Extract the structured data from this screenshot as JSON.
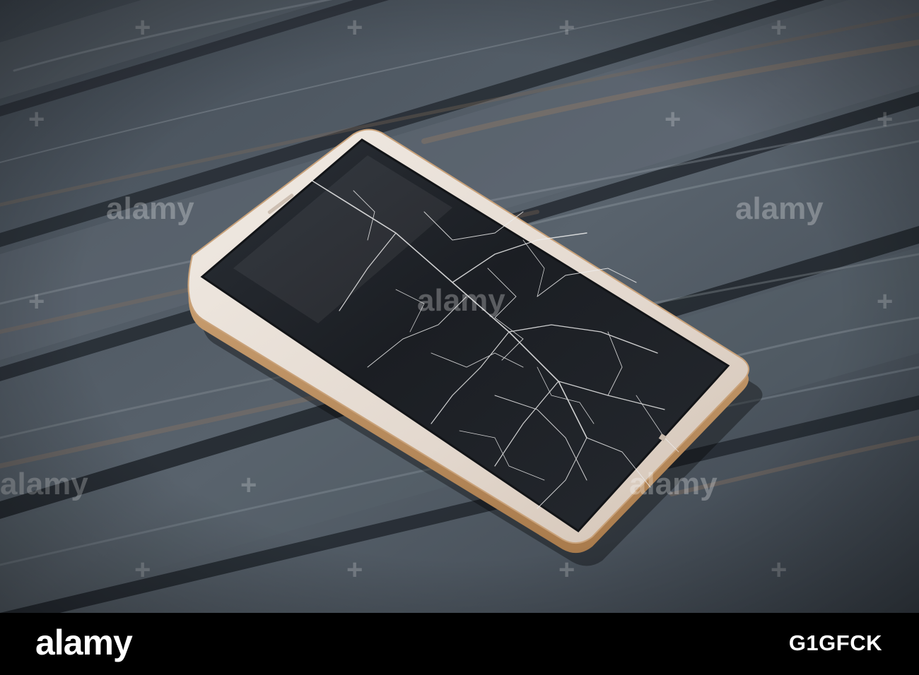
{
  "watermark": {
    "brand": "alamy",
    "plus_mark": "+"
  },
  "footer": {
    "brand": "alamy",
    "image_id": "G1GFCK"
  },
  "colors": {
    "wood_base": "#4b5560",
    "wood_light": "#8a939c",
    "wood_warm": "#9a7860",
    "phone_body": "#e6ddd4",
    "phone_rim": "#c79c6a",
    "screen_glass": "#1c1f24",
    "crack": "#f2f2f2",
    "footer_bg": "#000000",
    "footer_text": "#ffffff"
  }
}
